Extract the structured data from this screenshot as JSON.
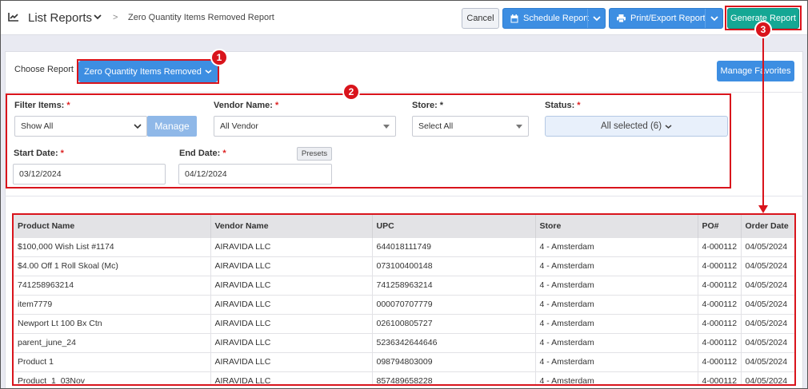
{
  "header": {
    "title": "List Reports",
    "breadcrumb_separator": ">",
    "breadcrumb": "Zero Quantity Items Removed Report",
    "cancel_label": "Cancel",
    "schedule_label": "Schedule Report",
    "print_label": "Print/Export Report",
    "generate_label": "Generate Report"
  },
  "choose": {
    "label": "Choose Report",
    "selected": "Zero Quantity Items Removed",
    "manage_favorites": "Manage Favorites"
  },
  "filters": {
    "filter_items": {
      "label": "Filter Items:",
      "value": "Show All",
      "manage_label": "Manage"
    },
    "vendor": {
      "label": "Vendor Name:",
      "value": "All Vendor"
    },
    "store": {
      "label": "Store:",
      "value": "Select All"
    },
    "status": {
      "label": "Status:",
      "value": "All selected (6)"
    },
    "start_date": {
      "label": "Start Date:",
      "value": "03/12/2024"
    },
    "end_date": {
      "label": "End Date:",
      "value": "04/12/2024"
    },
    "presets_label": "Presets",
    "required_mark": "*"
  },
  "table": {
    "columns": [
      "Product Name",
      "Vendor Name",
      "UPC",
      "Store",
      "PO#",
      "Order Date"
    ],
    "rows": [
      [
        "$100,000 Wish List #1174",
        "AIRAVIDA LLC",
        "644018111749",
        "4 - Amsterdam",
        "4-000112",
        "04/05/2024"
      ],
      [
        "$4.00 Off 1 Roll Skoal (Mc)",
        "AIRAVIDA LLC",
        "073100400148",
        "4 - Amsterdam",
        "4-000112",
        "04/05/2024"
      ],
      [
        "741258963214",
        "AIRAVIDA LLC",
        "741258963214",
        "4 - Amsterdam",
        "4-000112",
        "04/05/2024"
      ],
      [
        "item7779",
        "AIRAVIDA LLC",
        "000070707779",
        "4 - Amsterdam",
        "4-000112",
        "04/05/2024"
      ],
      [
        "Newport Lt 100 Bx Ctn",
        "AIRAVIDA LLC",
        "026100805727",
        "4 - Amsterdam",
        "4-000112",
        "04/05/2024"
      ],
      [
        "parent_june_24",
        "AIRAVIDA LLC",
        "5236342644646",
        "4 - Amsterdam",
        "4-000112",
        "04/05/2024"
      ],
      [
        "Product 1",
        "AIRAVIDA LLC",
        "098794803009",
        "4 - Amsterdam",
        "4-000112",
        "04/05/2024"
      ],
      [
        "Product_1_03Nov",
        "AIRAVIDA LLC",
        "857489658228",
        "4 - Amsterdam",
        "4-000112",
        "04/05/2024"
      ]
    ]
  },
  "annotations": {
    "badge1": "1",
    "badge2": "2",
    "badge3": "3"
  },
  "colors": {
    "accent": "#3d8ee2",
    "generate": "#14a794",
    "annotation": "#d9141c"
  },
  "icons": [
    "chart-icon",
    "chevron-down-icon",
    "calendar-icon",
    "printer-icon"
  ]
}
